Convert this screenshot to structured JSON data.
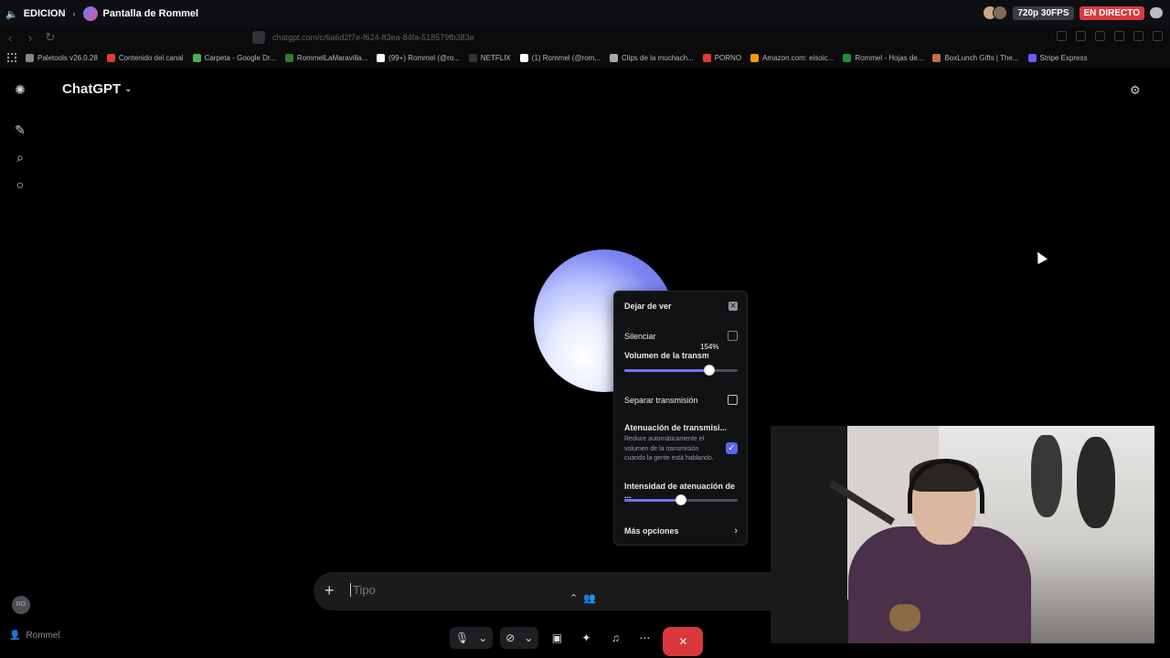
{
  "stream_bar": {
    "channel": "EDICION",
    "stream_title": "Pantalla de Rommel",
    "quality": "720p 30FPS",
    "live": "EN DIRECTO"
  },
  "browser": {
    "url": "chatgpt.com/c/6a6d2f7e-f624-83ea-84fa-518579fb383e",
    "bookmarks": [
      {
        "label": "Paletools v26.0.28",
        "color": "#888888"
      },
      {
        "label": "Contenido del canal",
        "color": "#e53935"
      },
      {
        "label": "Carpeta - Google Dr...",
        "color": "#4caf50"
      },
      {
        "label": "RommelLaMaravilla...",
        "color": "#2e7d32"
      },
      {
        "label": "(99+) Rommel (@ro...",
        "color": "#ffffff"
      },
      {
        "label": "NETFLIX",
        "color": "#333333"
      },
      {
        "label": "(1) Rommel (@rom...",
        "color": "#ffffff"
      },
      {
        "label": "Clips de la muchach...",
        "color": "#aaaaaa"
      },
      {
        "label": "PORNO",
        "color": "#e53935"
      },
      {
        "label": "Amazon.com: eisoic...",
        "color": "#ff9900"
      },
      {
        "label": "Rommel - Hojas de...",
        "color": "#1e8e3e"
      },
      {
        "label": "BoxLunch Gifts | The...",
        "color": "#c0704a"
      },
      {
        "label": "Stripe Express",
        "color": "#6b5bff"
      }
    ]
  },
  "chatgpt": {
    "title": "ChatGPT",
    "composer_placeholder": "Tipo"
  },
  "stream_menu": {
    "stop_watching": "Dejar de ver",
    "mute": "Silenciar",
    "volume_label": "Volumen de la transmisión",
    "volume_percent": 154,
    "volume_tooltip": "154%",
    "volume_fill_fraction": 0.75,
    "popout": "Separar transmisión",
    "attenuation_title": "Atenuación de transmisi...",
    "attenuation_desc": "Reduce automáticamente el volumen de la transmisión cuando la gente está hablando.",
    "attenuation_checked": true,
    "attenuation_intensity_label": "Intensidad de atenuación de ...",
    "attenuation_fill_fraction": 0.5,
    "more_options": "Más opciones"
  },
  "voice": {
    "self_user": "Rommel"
  },
  "colors": {
    "live": "#d83a42",
    "accent": "#5865f2",
    "end_call": "#da373c"
  }
}
